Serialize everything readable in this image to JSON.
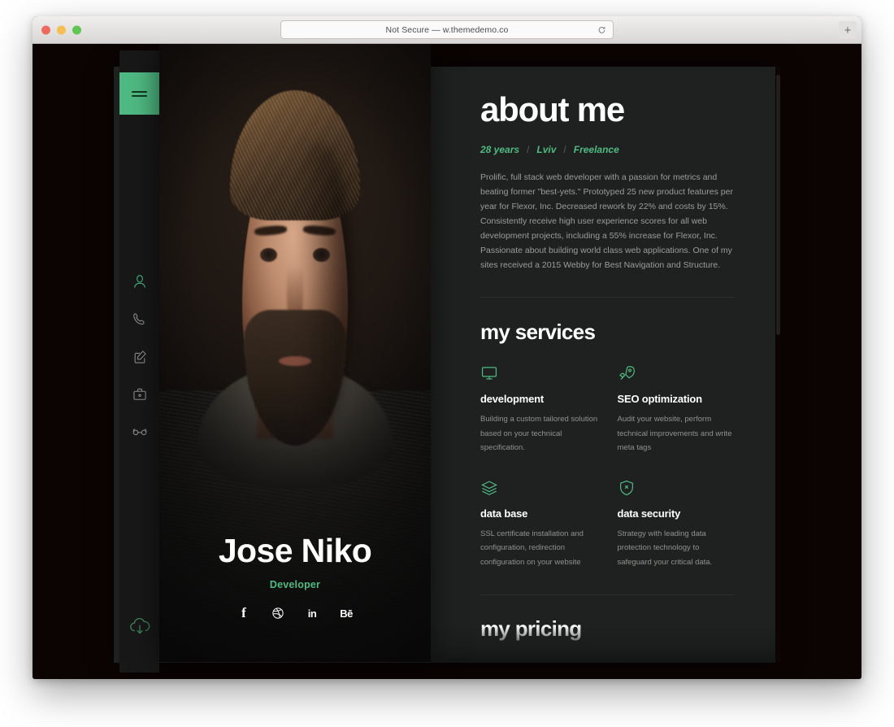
{
  "browser": {
    "url_text": "Not Secure — w.themedemo.co",
    "reload_label": "",
    "new_tab_label": "+"
  },
  "nav": {
    "menu_label": "",
    "items": [
      {
        "name": "about",
        "icon": "person-icon",
        "active": true
      },
      {
        "name": "contact",
        "icon": "phone-icon",
        "active": false
      },
      {
        "name": "resume",
        "icon": "edit-icon",
        "active": false
      },
      {
        "name": "portfolio",
        "icon": "briefcase-icon",
        "active": false
      },
      {
        "name": "blog",
        "icon": "glasses-icon",
        "active": false
      }
    ],
    "download_label": ""
  },
  "profile": {
    "name": "Jose Niko",
    "role": "Developer",
    "socials": [
      {
        "label": "f",
        "name": "facebook"
      },
      {
        "label": "",
        "name": "dribbble"
      },
      {
        "label": "in",
        "name": "linkedin"
      },
      {
        "label": "Bē",
        "name": "behance"
      }
    ]
  },
  "about": {
    "title": "about me",
    "meta": [
      "28 years",
      "Lviv",
      "Freelance"
    ],
    "separator": "/",
    "text": "Prolific, full stack web developer with a passion for metrics and beating former \"best-yets.\" Prototyped 25 new product features per year for Flexor, Inc. Decreased rework by 22% and costs by 15%. Consistently receive high user experience scores for all web development projects, including a 55% increase for Flexor, Inc. Passionate about building world class web applications. One of my sites received a 2015 Webby for Best Navigation and Structure."
  },
  "services": {
    "title": "my services",
    "items": [
      {
        "icon": "monitor-icon",
        "name": "development",
        "desc": "Building a custom tailored solution based on your technical specification."
      },
      {
        "icon": "rocket-icon",
        "name": "SEO optimization",
        "desc": "Audit your website, perform technical improvements and write meta tags"
      },
      {
        "icon": "layers-icon",
        "name": "data base",
        "desc": "SSL certificate installation and configuration, redirection configuration on your website"
      },
      {
        "icon": "shield-x-icon",
        "name": "data security",
        "desc": "Strategy with leading data protection technology to safeguard your critical data."
      }
    ]
  },
  "pricing": {
    "title": "my pricing"
  },
  "colors": {
    "accent": "#4fba83",
    "panel": "#1f2120",
    "sidebar": "#171817",
    "page_bg": "#0b0403",
    "body_text": "#9a9d9b"
  }
}
